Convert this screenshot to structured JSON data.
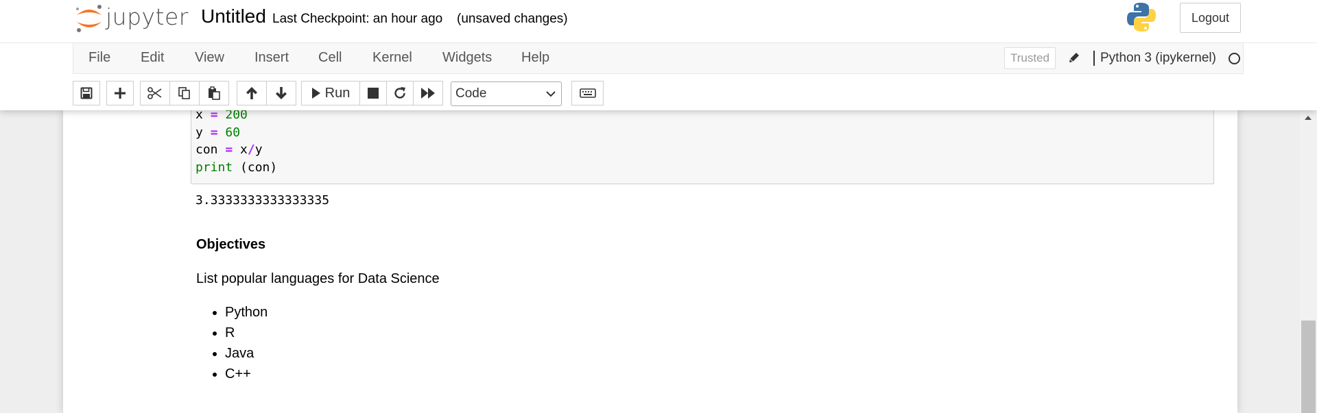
{
  "header": {
    "logo_text": "jupyter",
    "notebook_name": "Untitled",
    "checkpoint": "Last Checkpoint: an hour ago",
    "autosave_status": "(unsaved changes)",
    "logout_label": "Logout"
  },
  "menubar": {
    "items": [
      "File",
      "Edit",
      "View",
      "Insert",
      "Cell",
      "Kernel",
      "Widgets",
      "Help"
    ],
    "trusted_label": "Trusted",
    "kernel_name": "Python 3 (ipykernel)"
  },
  "toolbar": {
    "buttons": [
      "save-icon",
      "plus-icon",
      "cut-icon",
      "copy-icon",
      "paste-icon",
      "arrow-up-icon",
      "arrow-down-icon",
      "run-icon",
      "stop-icon",
      "restart-icon",
      "fast-forward-icon",
      "keyboard-icon"
    ],
    "run_label": "Run",
    "cell_type": "Code"
  },
  "cells": {
    "code_lines": [
      {
        "var": "x",
        "op": "=",
        "val": "200"
      },
      {
        "var": "y",
        "op": "=",
        "val": "60"
      },
      {
        "var": "con",
        "op": "=",
        "expr_a": "x",
        "expr_op": "/",
        "expr_b": "y"
      },
      {
        "kw": "print",
        "rest": " (con)"
      }
    ],
    "output": "3.3333333333333335",
    "markdown": {
      "heading": "Objectives",
      "paragraph": "List popular languages for Data Science",
      "list": [
        "Python",
        "R",
        "Java",
        "C++"
      ]
    }
  },
  "colors": {
    "accent_orange": "#f37726",
    "code_keyword_green": "#008000",
    "code_operator_purple": "#aa22ff"
  }
}
